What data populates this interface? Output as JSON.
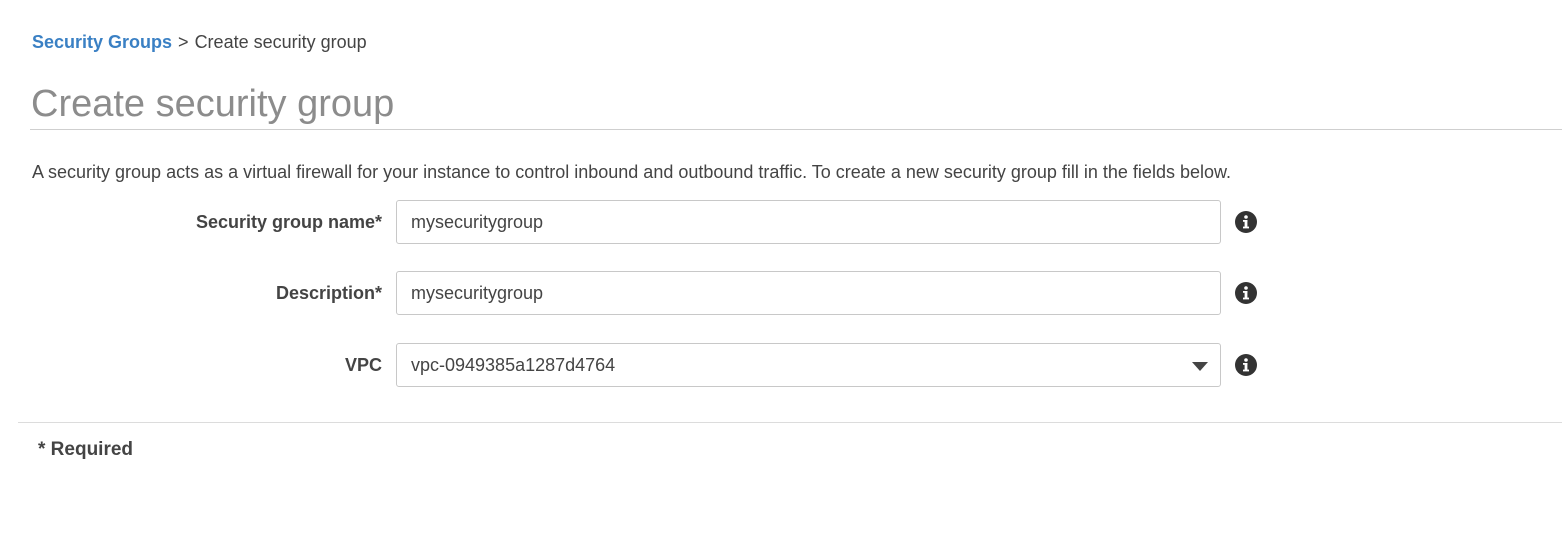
{
  "breadcrumb": {
    "parent_label": "Security Groups",
    "separator": ">",
    "current_label": "Create security group"
  },
  "page": {
    "title": "Create security group",
    "intro": "A security group acts as a virtual firewall for your instance to control inbound and outbound traffic. To create a new security group fill in the fields below."
  },
  "form": {
    "name": {
      "label": "Security group name*",
      "value": "mysecuritygroup",
      "info_icon": "info-icon"
    },
    "description": {
      "label": "Description*",
      "value": "mysecuritygroup",
      "info_icon": "info-icon"
    },
    "vpc": {
      "label": "VPC",
      "selected_value": "vpc-0949385a1287d4764",
      "dropdown_icon": "chevron-down-icon",
      "info_icon": "info-icon"
    }
  },
  "footer": {
    "required_note": "* Required"
  },
  "colors": {
    "link": "#3a80c4",
    "title": "#8c8c8c",
    "text": "#444444",
    "border": "#c8c8c8"
  }
}
